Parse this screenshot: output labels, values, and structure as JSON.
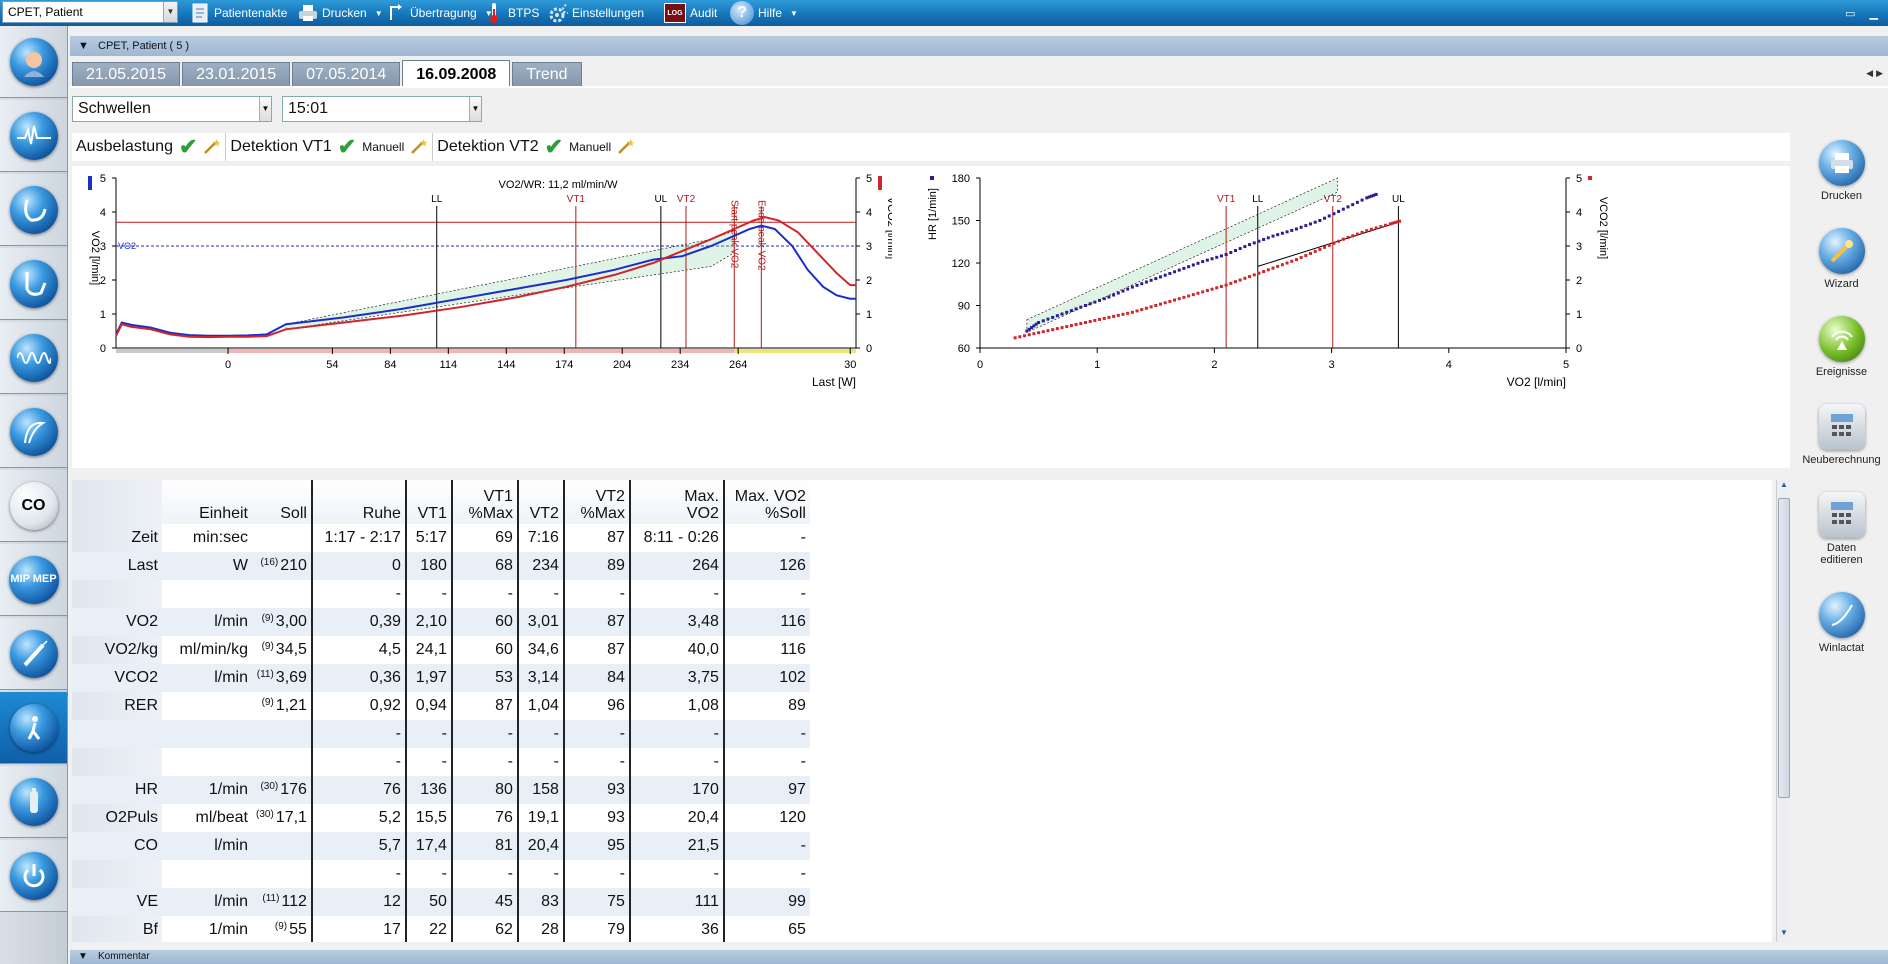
{
  "topbar": {
    "patient_combo": "CPET, Patient",
    "items": [
      {
        "label": "Patientenakte",
        "icon": "patient-record-icon"
      },
      {
        "label": "Drucken",
        "icon": "printer-icon"
      },
      {
        "label": "Übertragung",
        "icon": "transfer-icon"
      },
      {
        "label": "BTPS",
        "icon": "thermometer-icon"
      },
      {
        "label": "Einstellungen",
        "icon": "gear-icon"
      },
      {
        "label": "Audit",
        "icon": "log-icon",
        "icon_text": "LOG"
      },
      {
        "label": "Hilfe",
        "icon": "help-icon"
      }
    ]
  },
  "leftnav": {
    "items": [
      {
        "name": "patient-nav",
        "icon": "patient-face-icon",
        "text": ""
      },
      {
        "name": "ecg-nav",
        "icon": "ecg-wave-icon",
        "text": ""
      },
      {
        "name": "lung-nav",
        "icon": "lung-icon",
        "text": ""
      },
      {
        "name": "spirometry-nav",
        "icon": "spirometry-icon",
        "text": ""
      },
      {
        "name": "breathing-nav",
        "icon": "breath-wave-icon",
        "text": ""
      },
      {
        "name": "flow-loop-nav",
        "icon": "flow-loop-icon",
        "text": ""
      },
      {
        "name": "co-nav",
        "icon": "co-icon",
        "text": "CO"
      },
      {
        "name": "mip-mep-nav",
        "icon": "mip-mep-icon",
        "text": "MIP MEP"
      },
      {
        "name": "tools-nav",
        "icon": "syringe-icon",
        "text": ""
      },
      {
        "name": "cpet-nav",
        "icon": "cpet-runner-icon",
        "text": ""
      },
      {
        "name": "co2-nav",
        "icon": "co2-bottle-icon",
        "text": ""
      },
      {
        "name": "power-nav",
        "icon": "power-icon",
        "text": ""
      }
    ],
    "active_index": 9
  },
  "header": {
    "title": "CPET, Patient ( 5 )"
  },
  "tabs": {
    "items": [
      "21.05.2015",
      "23.01.2015",
      "07.05.2014",
      "16.09.2008",
      "Trend"
    ],
    "active_index": 3
  },
  "selectors": {
    "view": "Schwellen",
    "time": "15:01"
  },
  "detection": {
    "ausbelastung": "Ausbelastung",
    "vt1": "Detektion VT1",
    "vt1_mode": "Manuell",
    "vt2": "Detektion VT2",
    "vt2_mode": "Manuell"
  },
  "rightnav": {
    "items": [
      {
        "label": "Drucken",
        "icon": "printer-icon"
      },
      {
        "label": "Wizard",
        "icon": "wand-icon"
      },
      {
        "label": "Ereignisse",
        "icon": "events-icon"
      },
      {
        "label": "Neuberechnung",
        "icon": "calculator-icon"
      },
      {
        "label": "Daten editieren",
        "icon": "calculator-edit-icon"
      },
      {
        "label": "Winlactat",
        "icon": "lactate-icon"
      }
    ]
  },
  "colors": {
    "vo2": "#1a2ec8",
    "vco2": "#d0262b",
    "hr": "#2b1f8f",
    "threshold": "#b01a1a",
    "accent": "#1473b8"
  },
  "chart_data": [
    {
      "type": "line",
      "title": "",
      "annotation": "VO2/WR: 11,2 ml/min/W",
      "xlabel": "Last [W]",
      "ylabel_left": "VO2 [l/min]",
      "ylabel_right": "VCO2 [l/min]",
      "x_ticks": [
        "0",
        "54",
        "84",
        "114",
        "144",
        "174",
        "204",
        "234",
        "264",
        "30"
      ],
      "y_ticks": [
        "0",
        "1",
        "2",
        "3",
        "4",
        "5"
      ],
      "ylim": [
        0,
        5
      ],
      "vo2_soll_label": "VO2",
      "vo2_soll_value": 3.0,
      "ausbelastung_line": 3.7,
      "vertical_markers": [
        {
          "label": "LL",
          "x": 108,
          "color": "black"
        },
        {
          "label": "VT1",
          "x": 180,
          "color": "red"
        },
        {
          "label": "UL",
          "x": 224,
          "color": "black"
        },
        {
          "label": "VT2",
          "x": 237,
          "color": "red"
        },
        {
          "label": "Start peak VO2",
          "x": 262,
          "color": "red"
        },
        {
          "label": "Ende peak VO2",
          "x": 276,
          "color": "red"
        }
      ],
      "series": [
        {
          "name": "VO2",
          "color": "#1a2ec8",
          "points": [
            [
              -58,
              0.4
            ],
            [
              -55,
              0.75
            ],
            [
              -50,
              0.68
            ],
            [
              -40,
              0.6
            ],
            [
              -30,
              0.45
            ],
            [
              -20,
              0.38
            ],
            [
              -10,
              0.36
            ],
            [
              0,
              0.36
            ],
            [
              10,
              0.37
            ],
            [
              20,
              0.4
            ],
            [
              30,
              0.7
            ],
            [
              60,
              0.9
            ],
            [
              90,
              1.15
            ],
            [
              120,
              1.45
            ],
            [
              150,
              1.75
            ],
            [
              175,
              2.0
            ],
            [
              200,
              2.3
            ],
            [
              220,
              2.6
            ],
            [
              235,
              2.7
            ],
            [
              250,
              3.0
            ],
            [
              262,
              3.3
            ],
            [
              270,
              3.5
            ],
            [
              276,
              3.6
            ],
            [
              283,
              3.5
            ],
            [
              292,
              3.0
            ],
            [
              300,
              2.3
            ],
            [
              308,
              1.8
            ],
            [
              315,
              1.55
            ],
            [
              322,
              1.45
            ],
            [
              325,
              1.45
            ]
          ]
        },
        {
          "name": "VCO2",
          "color": "#d0262b",
          "points": [
            [
              -58,
              0.35
            ],
            [
              -55,
              0.7
            ],
            [
              -50,
              0.62
            ],
            [
              -40,
              0.55
            ],
            [
              -30,
              0.4
            ],
            [
              -20,
              0.33
            ],
            [
              -10,
              0.32
            ],
            [
              0,
              0.33
            ],
            [
              10,
              0.33
            ],
            [
              20,
              0.35
            ],
            [
              30,
              0.55
            ],
            [
              60,
              0.75
            ],
            [
              90,
              0.95
            ],
            [
              120,
              1.2
            ],
            [
              150,
              1.5
            ],
            [
              175,
              1.8
            ],
            [
              200,
              2.15
            ],
            [
              220,
              2.5
            ],
            [
              235,
              2.85
            ],
            [
              250,
              3.2
            ],
            [
              262,
              3.5
            ],
            [
              272,
              3.75
            ],
            [
              278,
              3.85
            ],
            [
              285,
              3.75
            ],
            [
              295,
              3.4
            ],
            [
              305,
              2.8
            ],
            [
              315,
              2.2
            ],
            [
              322,
              1.85
            ],
            [
              325,
              1.85
            ]
          ]
        }
      ]
    },
    {
      "type": "scatter",
      "title": "",
      "xlabel": "VO2 [l/min]",
      "ylabel_left": "HR [1/min]",
      "ylabel_right": "VCO2 [l/min]",
      "x_ticks": [
        "0",
        "1",
        "2",
        "3",
        "4",
        "5"
      ],
      "y_ticks_left": [
        "60",
        "90",
        "120",
        "150",
        "180"
      ],
      "y_ticks_right": [
        "0",
        "1",
        "2",
        "3",
        "4",
        "5"
      ],
      "xlim": [
        0,
        5
      ],
      "ylim_left": [
        60,
        180
      ],
      "ylim_right": [
        0,
        5
      ],
      "vertical_markers": [
        {
          "label": "VT1",
          "x": 2.1,
          "color": "red"
        },
        {
          "label": "LL",
          "x": 2.37,
          "color": "black"
        },
        {
          "label": "VT2",
          "x": 3.01,
          "color": "red"
        },
        {
          "label": "UL",
          "x": 3.57,
          "color": "black"
        }
      ],
      "series": [
        {
          "name": "HR",
          "color": "#2b1f8f",
          "points": [
            [
              0.4,
              72
            ],
            [
              0.5,
              78
            ],
            [
              0.7,
              84
            ],
            [
              0.9,
              90
            ],
            [
              1.1,
              96
            ],
            [
              1.3,
              103
            ],
            [
              1.5,
              109
            ],
            [
              1.7,
              115
            ],
            [
              1.9,
              121
            ],
            [
              2.1,
              126
            ],
            [
              2.3,
              133
            ],
            [
              2.5,
              139
            ],
            [
              2.7,
              144
            ],
            [
              2.9,
              150
            ],
            [
              3.1,
              158
            ],
            [
              3.3,
              166
            ],
            [
              3.4,
              169
            ]
          ]
        },
        {
          "name": "VCO2",
          "color": "#d0262b",
          "points": [
            [
              0.3,
              0.3
            ],
            [
              0.5,
              0.45
            ],
            [
              0.7,
              0.6
            ],
            [
              0.9,
              0.75
            ],
            [
              1.1,
              0.9
            ],
            [
              1.3,
              1.05
            ],
            [
              1.5,
              1.25
            ],
            [
              1.7,
              1.45
            ],
            [
              1.9,
              1.65
            ],
            [
              2.1,
              1.85
            ],
            [
              2.3,
              2.1
            ],
            [
              2.5,
              2.35
            ],
            [
              2.7,
              2.6
            ],
            [
              2.9,
              2.9
            ],
            [
              3.1,
              3.2
            ],
            [
              3.3,
              3.45
            ],
            [
              3.5,
              3.65
            ],
            [
              3.6,
              3.75
            ]
          ]
        }
      ]
    }
  ],
  "table": {
    "headers": [
      "",
      "Einheit",
      "Soll",
      "Ruhe",
      "VT1",
      "VT1\n%Max",
      "VT2",
      "VT2\n%Max",
      "Max.\nVO2",
      "Max. VO2\n%Soll"
    ],
    "rows": [
      {
        "label": "Zeit",
        "unit": "min:sec",
        "sup": "",
        "soll": "",
        "ruhe": "1:17 - 2:17",
        "vt1": "5:17",
        "vt1p": "69",
        "vt2": "7:16",
        "vt2p": "87",
        "max": "8:11 - 0:26",
        "maxp": "-"
      },
      {
        "label": "Last",
        "unit": "W",
        "sup": "(16)",
        "soll": "210",
        "ruhe": "0",
        "vt1": "180",
        "vt1p": "68",
        "vt2": "234",
        "vt2p": "89",
        "max": "264",
        "maxp": "126"
      },
      {
        "label": "",
        "unit": "",
        "sup": "",
        "soll": "",
        "ruhe": "-",
        "vt1": "-",
        "vt1p": "-",
        "vt2": "-",
        "vt2p": "-",
        "max": "-",
        "maxp": "-"
      },
      {
        "label": "VO2",
        "unit": "l/min",
        "sup": "(9)",
        "soll": "3,00",
        "ruhe": "0,39",
        "vt1": "2,10",
        "vt1p": "60",
        "vt2": "3,01",
        "vt2p": "87",
        "max": "3,48",
        "maxp": "116"
      },
      {
        "label": "VO2/kg",
        "unit": "ml/min/kg",
        "sup": "(9)",
        "soll": "34,5",
        "ruhe": "4,5",
        "vt1": "24,1",
        "vt1p": "60",
        "vt2": "34,6",
        "vt2p": "87",
        "max": "40,0",
        "maxp": "116"
      },
      {
        "label": "VCO2",
        "unit": "l/min",
        "sup": "(11)",
        "soll": "3,69",
        "ruhe": "0,36",
        "vt1": "1,97",
        "vt1p": "53",
        "vt2": "3,14",
        "vt2p": "84",
        "max": "3,75",
        "maxp": "102"
      },
      {
        "label": "RER",
        "unit": "",
        "sup": "(9)",
        "soll": "1,21",
        "ruhe": "0,92",
        "vt1": "0,94",
        "vt1p": "87",
        "vt2": "1,04",
        "vt2p": "96",
        "max": "1,08",
        "maxp": "89"
      },
      {
        "label": "",
        "unit": "",
        "sup": "",
        "soll": "",
        "ruhe": "-",
        "vt1": "-",
        "vt1p": "-",
        "vt2": "-",
        "vt2p": "-",
        "max": "-",
        "maxp": "-"
      },
      {
        "label": "",
        "unit": "",
        "sup": "",
        "soll": "",
        "ruhe": "-",
        "vt1": "-",
        "vt1p": "-",
        "vt2": "-",
        "vt2p": "-",
        "max": "-",
        "maxp": "-"
      },
      {
        "label": "HR",
        "unit": "1/min",
        "sup": "(30)",
        "soll": "176",
        "ruhe": "76",
        "vt1": "136",
        "vt1p": "80",
        "vt2": "158",
        "vt2p": "93",
        "max": "170",
        "maxp": "97"
      },
      {
        "label": "O2Puls",
        "unit": "ml/beat",
        "sup": "(30)",
        "soll": "17,1",
        "ruhe": "5,2",
        "vt1": "15,5",
        "vt1p": "76",
        "vt2": "19,1",
        "vt2p": "93",
        "max": "20,4",
        "maxp": "120"
      },
      {
        "label": "CO",
        "unit": "l/min",
        "sup": "",
        "soll": "",
        "ruhe": "5,7",
        "vt1": "17,4",
        "vt1p": "81",
        "vt2": "20,4",
        "vt2p": "95",
        "max": "21,5",
        "maxp": "-"
      },
      {
        "label": "",
        "unit": "",
        "sup": "",
        "soll": "",
        "ruhe": "-",
        "vt1": "-",
        "vt1p": "-",
        "vt2": "-",
        "vt2p": "-",
        "max": "-",
        "maxp": "-"
      },
      {
        "label": "VE",
        "unit": "l/min",
        "sup": "(11)",
        "soll": "112",
        "ruhe": "12",
        "vt1": "50",
        "vt1p": "45",
        "vt2": "83",
        "vt2p": "75",
        "max": "111",
        "maxp": "99"
      },
      {
        "label": "Bf",
        "unit": "1/min",
        "sup": "(9)",
        "soll": "55",
        "ruhe": "17",
        "vt1": "22",
        "vt1p": "62",
        "vt2": "28",
        "vt2p": "79",
        "max": "36",
        "maxp": "65"
      }
    ]
  },
  "footer": {
    "title": "Kommentar"
  }
}
